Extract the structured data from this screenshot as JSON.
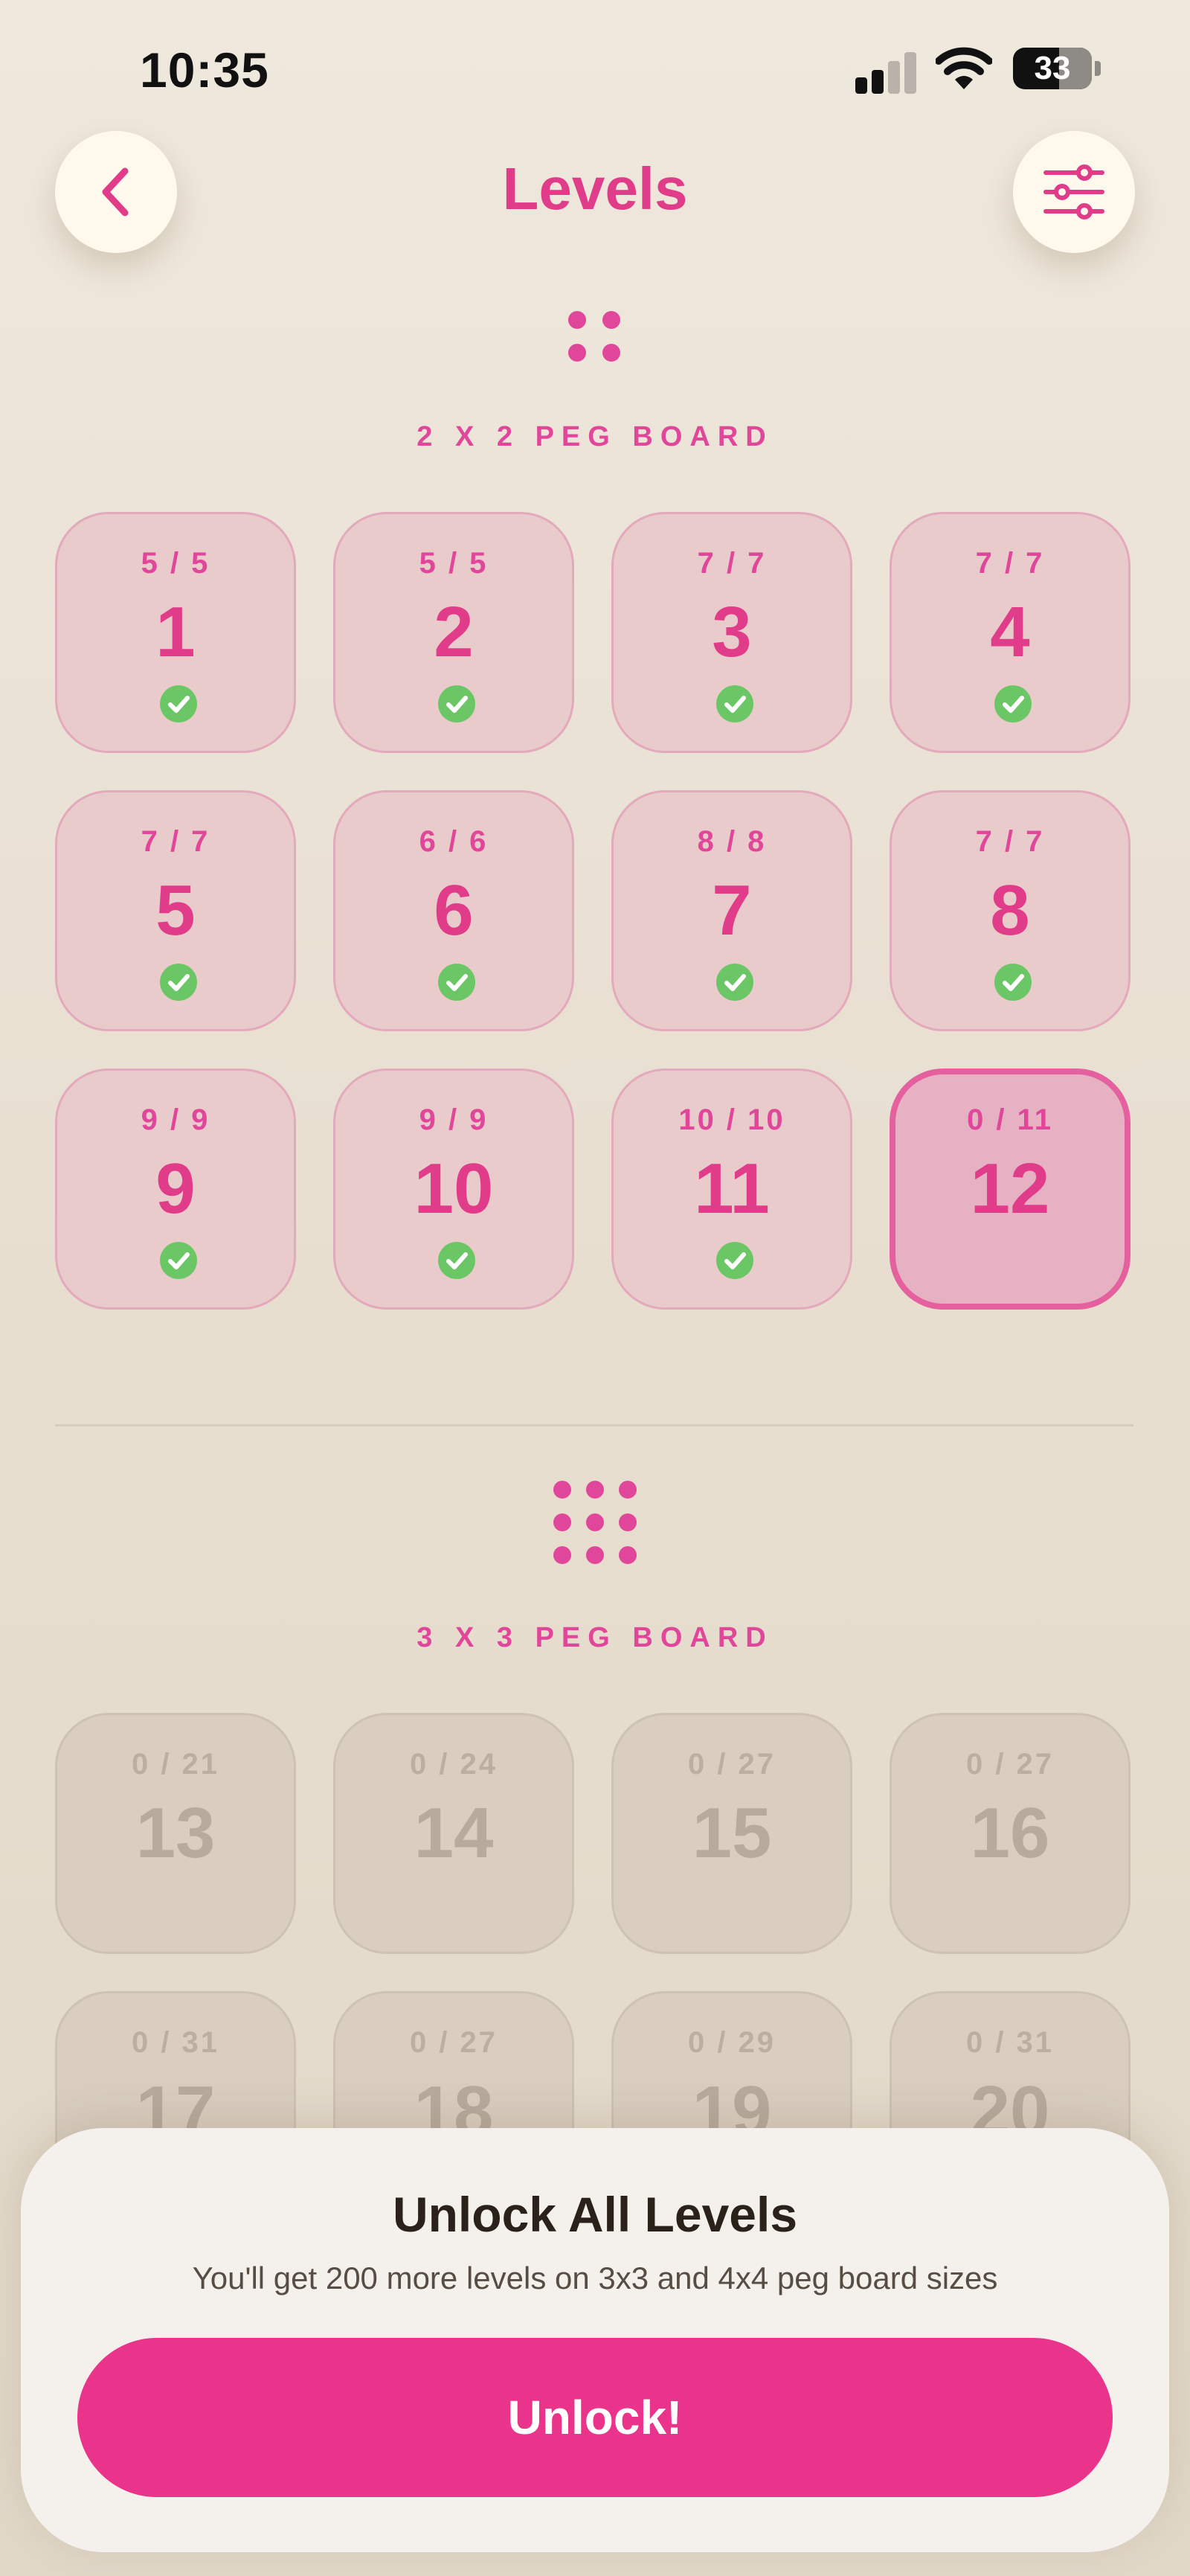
{
  "status_bar": {
    "time": "10:35",
    "battery": "33"
  },
  "header": {
    "title": "Levels"
  },
  "boards": [
    {
      "label": "2 X 2 PEG BOARD",
      "levels": [
        {
          "number": "1",
          "score": "5 / 5",
          "state": "done"
        },
        {
          "number": "2",
          "score": "5 / 5",
          "state": "done"
        },
        {
          "number": "3",
          "score": "7 / 7",
          "state": "done"
        },
        {
          "number": "4",
          "score": "7 / 7",
          "state": "done"
        },
        {
          "number": "5",
          "score": "7 / 7",
          "state": "done"
        },
        {
          "number": "6",
          "score": "6 / 6",
          "state": "done"
        },
        {
          "number": "7",
          "score": "8 / 8",
          "state": "done"
        },
        {
          "number": "8",
          "score": "7 / 7",
          "state": "done"
        },
        {
          "number": "9",
          "score": "9 / 9",
          "state": "done"
        },
        {
          "number": "10",
          "score": "9 / 9",
          "state": "done"
        },
        {
          "number": "11",
          "score": "10 / 10",
          "state": "done"
        },
        {
          "number": "12",
          "score": "0 / 11",
          "state": "current"
        }
      ]
    },
    {
      "label": "3 X 3 PEG BOARD",
      "levels": [
        {
          "number": "13",
          "score": "0 / 21",
          "state": "locked"
        },
        {
          "number": "14",
          "score": "0 / 24",
          "state": "locked"
        },
        {
          "number": "15",
          "score": "0 / 27",
          "state": "locked"
        },
        {
          "number": "16",
          "score": "0 / 27",
          "state": "locked"
        },
        {
          "number": "17",
          "score": "0 / 31",
          "state": "locked"
        },
        {
          "number": "18",
          "score": "0 / 27",
          "state": "locked"
        },
        {
          "number": "19",
          "score": "0 / 29",
          "state": "locked"
        },
        {
          "number": "20",
          "score": "0 / 31",
          "state": "locked"
        }
      ]
    }
  ],
  "unlock": {
    "title": "Unlock All Levels",
    "subtitle": "You'll get 200 more levels on 3x3 and 4x4 peg board sizes",
    "button": "Unlock!"
  },
  "colors": {
    "accent": "#E03C8A",
    "check": "#6BC766",
    "button": "#EA338A"
  }
}
